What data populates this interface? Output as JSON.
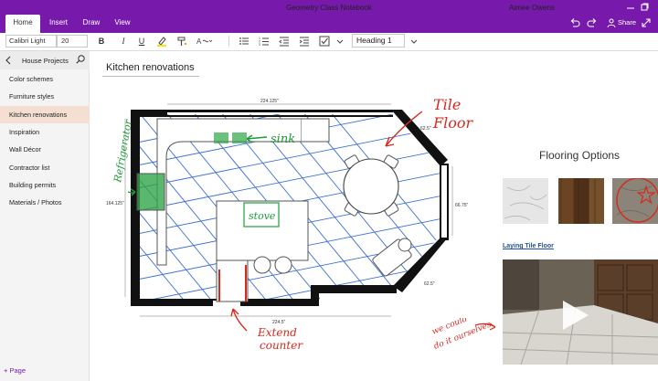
{
  "window": {
    "app_title": "Geometry Class Notebook",
    "user_name": "Aimee Owens",
    "share_label": "Share"
  },
  "ribbon": {
    "tabs": [
      {
        "label": "Home",
        "active": true
      },
      {
        "label": "Insert",
        "active": false
      },
      {
        "label": "Draw",
        "active": false
      },
      {
        "label": "View",
        "active": false
      }
    ],
    "font_name": "Calibri Light",
    "font_size": "20",
    "bold": "B",
    "italic": "I",
    "underline": "U",
    "paragraph_style": "Heading 1"
  },
  "sidebar": {
    "section_title": "House Projects",
    "pages": [
      {
        "label": "Color schemes",
        "selected": false
      },
      {
        "label": "Furniture styles",
        "selected": false
      },
      {
        "label": "Kitchen renovations",
        "selected": true
      },
      {
        "label": "Inspiration",
        "selected": false
      },
      {
        "label": "Wall Décor",
        "selected": false
      },
      {
        "label": "Contractor list",
        "selected": false
      },
      {
        "label": "Building permits",
        "selected": false
      },
      {
        "label": "Materials / Photos",
        "selected": false
      }
    ],
    "add_page_label": "Page"
  },
  "page": {
    "title": "Kitchen renovations",
    "floorplan": {
      "dim_top": "224.125\"",
      "dim_left": "164.125\"",
      "dim_right": "66.75\"",
      "dim_diag_top": "62.5\"",
      "dim_diag_bottom": "62.5\"",
      "dim_bottom": "224.5\""
    },
    "annotations": {
      "tile_floor_1": "Tile",
      "tile_floor_2": "Floor",
      "sink": "sink",
      "refrigerator": "Refrigerator",
      "stove": "stove",
      "extend_1": "Extend",
      "extend_2": "counter",
      "we_could_1": "we could",
      "we_could_2": "do it ourselves"
    },
    "flooring_title": "Flooring Options",
    "laying_link": "Laying Tile Floor"
  },
  "colors": {
    "accent": "#7719aa",
    "selected_page": "#f5dfd2",
    "ink_red": "#d42a1f",
    "ink_green": "#1e9a3a",
    "grid_blue": "#3d6fd4"
  }
}
